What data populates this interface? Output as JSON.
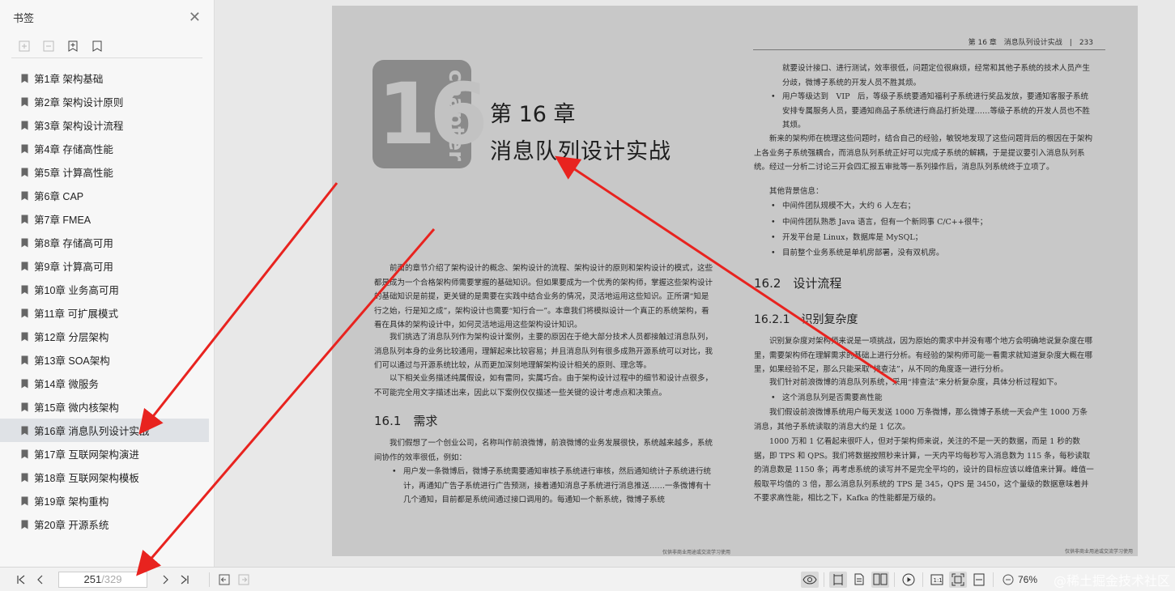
{
  "sidebar": {
    "title": "书签",
    "close_icon": "close-icon",
    "tools": [
      "expand-all-icon",
      "collapse-all-icon",
      "add-bookmark-icon",
      "bookmark-icon"
    ],
    "chapters": [
      {
        "label": "第1章 架构基础"
      },
      {
        "label": "第2章 架构设计原则"
      },
      {
        "label": "第3章 架构设计流程"
      },
      {
        "label": "第4章 存储高性能"
      },
      {
        "label": "第5章 计算高性能"
      },
      {
        "label": "第6章 CAP"
      },
      {
        "label": "第7章 FMEA"
      },
      {
        "label": "第8章 存储高可用"
      },
      {
        "label": "第9章 计算高可用"
      },
      {
        "label": "第10章 业务高可用"
      },
      {
        "label": "第11章 可扩展模式"
      },
      {
        "label": "第12章 分层架构"
      },
      {
        "label": "第13章 SOA架构"
      },
      {
        "label": "第14章 微服务"
      },
      {
        "label": "第15章 微内核架构"
      },
      {
        "label": "第16章 消息队列设计实战",
        "active": true
      },
      {
        "label": "第17章 互联网架构演进"
      },
      {
        "label": "第18章 互联网架构模板"
      },
      {
        "label": "第19章 架构重构"
      },
      {
        "label": "第20章 开源系统"
      }
    ]
  },
  "page": {
    "running_head": "第 16 章　消息队列设计实战　|　233",
    "badge_number": "16",
    "badge_word": "chapter",
    "chapter_label": "第 16 章",
    "chapter_title": "消息队列设计实战",
    "left": {
      "intro_1": "前面的章节介绍了架构设计的概念、架构设计的流程、架构设计的原则和架构设计的模式，这些都是成为一个合格架构师需要掌握的基础知识。但如果要成为一个优秀的架构师，掌握这些架构设计的基础知识是前提，更关键的是需要在实践中结合业务的情况，灵活地运用这些知识。正所谓“知是行之始，行是知之成”，架构设计也需要“知行合一”。本章我们将模拟设计一个真正的系统架构，看看在具体的架构设计中，如何灵活地运用这些架构设计知识。",
      "intro_2": "我们挑选了消息队列作为架构设计案例，主要的原因在于绝大部分技术人员都接触过消息队列，消息队列本身的业务比较通用，理解起来比较容易；并且消息队列有很多成熟开源系统可以对比，我们可以通过与开源系统比较，从而更加深刻地理解架构设计相关的原则、理念等。",
      "intro_3": "以下相关业务描述纯属假设，如有雷同，实属巧合。由于架构设计过程中的细节和设计点很多，不可能完全用文字描述出来，因此以下案例仅仅描述一些关键的设计考虑点和决策点。",
      "sec_161": "16.1　需求",
      "req_1": "我们假想了一个创业公司，名称叫作前浪微博，前浪微博的业务发展很快，系统越来越多，系统间协作的效率很低，例如：",
      "req_bullet": "用户发一条微博后，微博子系统需要通知审核子系统进行审核，然后通知统计子系统进行统计，再通知广告子系统进行广告预测，接着通知消息子系统进行消息推送……一条微博有十几个通知，目前都是系统间通过接口调用的。每通知一个新系统，微博子系统",
      "footer": "仅供非商业用途或交流学习使用"
    },
    "right": {
      "cont_1": "就要设计接口、进行测试，效率很低，问题定位很麻烦，经常和其他子系统的技术人员产生分歧，微博子系统的开发人员不胜其烦。",
      "bullet_vip": "用户等级达到　VIP　后，等级子系统要通知福利子系统进行奖品发放，要通知客服子系统安排专属服务人员，要通知商品子系统进行商品打折处理……等级子系统的开发人员也不胜其烦。",
      "para_arch": "新来的架构师在梳理这些问题时，结合自己的经验，敏锐地发现了这些问题背后的根因在于架构上各业务子系统强耦合，而消息队列系统正好可以完成子系统的解耦，于是提议要引入消息队列系统。经过一分析二讨论三开会四汇报五审批等一系列操作后，消息队列系统终于立项了。",
      "bg_title": "其他背景信息：",
      "bg_items": [
        "中间件团队规模不大，大约 6 人左右；",
        "中间件团队熟悉 Java 语言，但有一个新同事 C/C++很牛；",
        "开发平台是 Linux，数据库是 MySQL；",
        "目前整个业务系统是单机房部署，没有双机房。"
      ],
      "sec_162": "16.2　设计流程",
      "sec_1621": "16.2.1　识别复杂度",
      "complex_1": "识别复杂度对架构师来说是一项挑战，因为原始的需求中并没有哪个地方会明确地说复杂度在哪里，需要架构师在理解需求的基础上进行分析。有经验的架构师可能一看需求就知道复杂度大概在哪里，如果经验不足，那么只能采取“排查法”，从不同的角度逐一进行分析。",
      "complex_2": "我们针对前浪微博的消息队列系统，采用“排查法”来分析复杂度，具体分析过程如下。",
      "bullet_perf": "这个消息队列是否需要高性能",
      "perf_1": "我们假设前浪微博系统用户每天发送 1000 万条微博，那么微博子系统一天会产生 1000 万条消息，其他子系统读取的消息大约是 1 亿次。",
      "perf_2": "1000 万和 1 亿看起来很吓人，但对于架构师来说，关注的不是一天的数据，而是 1 秒的数据，即 TPS 和 QPS。我们将数据按照秒来计算，一天内平均每秒写入消息数为 115 条，每秒读取的消息数是 1150 条；再考虑系统的读写并不是完全平均的，设计的目标应该以峰值来计算。峰值一般取平均值的 3 倍，那么消息队列系统的 TPS 是 345，QPS 是 3450，这个量级的数据意味着并不要求高性能，相比之下，Kafka 的性能都是万级的。",
      "footer": "仅供非商业用途或交流学习使用"
    }
  },
  "toolbar": {
    "page_current": "251",
    "page_total": "/329",
    "zoom": "76%",
    "watermark": "@稀土掘金技术社区"
  },
  "colors": {
    "arrow": "#e8231f",
    "active_item": "#dfe2e6"
  }
}
